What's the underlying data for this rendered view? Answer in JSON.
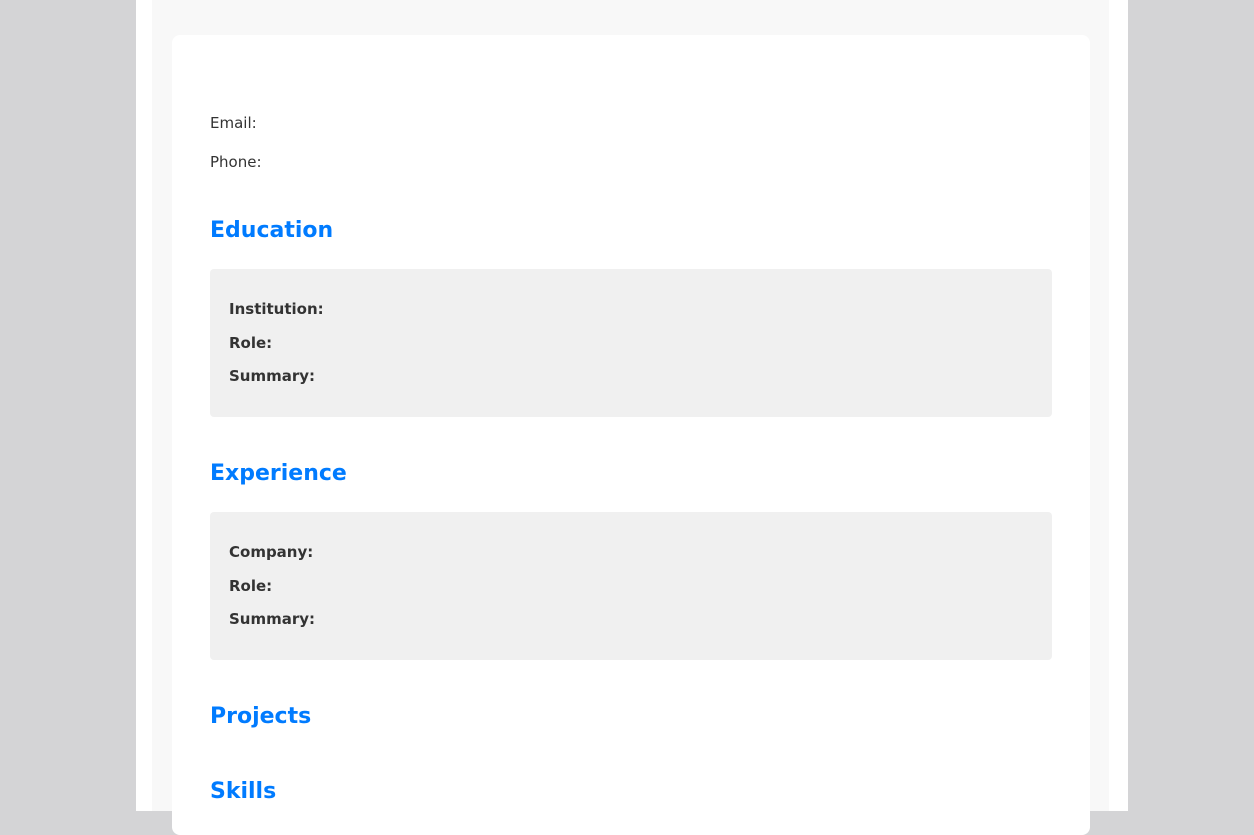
{
  "contact": {
    "email_label": "Email:",
    "phone_label": "Phone:"
  },
  "sections": {
    "education": {
      "title": "Education",
      "fields": [
        "Institution:",
        "Role:",
        "Summary:"
      ]
    },
    "experience": {
      "title": "Experience",
      "fields": [
        "Company:",
        "Role:",
        "Summary:"
      ]
    },
    "projects": {
      "title": "Projects"
    },
    "skills": {
      "title": "Skills"
    }
  },
  "colors": {
    "accent": "#007bff",
    "entry_bg": "#f0f0f0",
    "backdrop": "#d4d4d6"
  }
}
